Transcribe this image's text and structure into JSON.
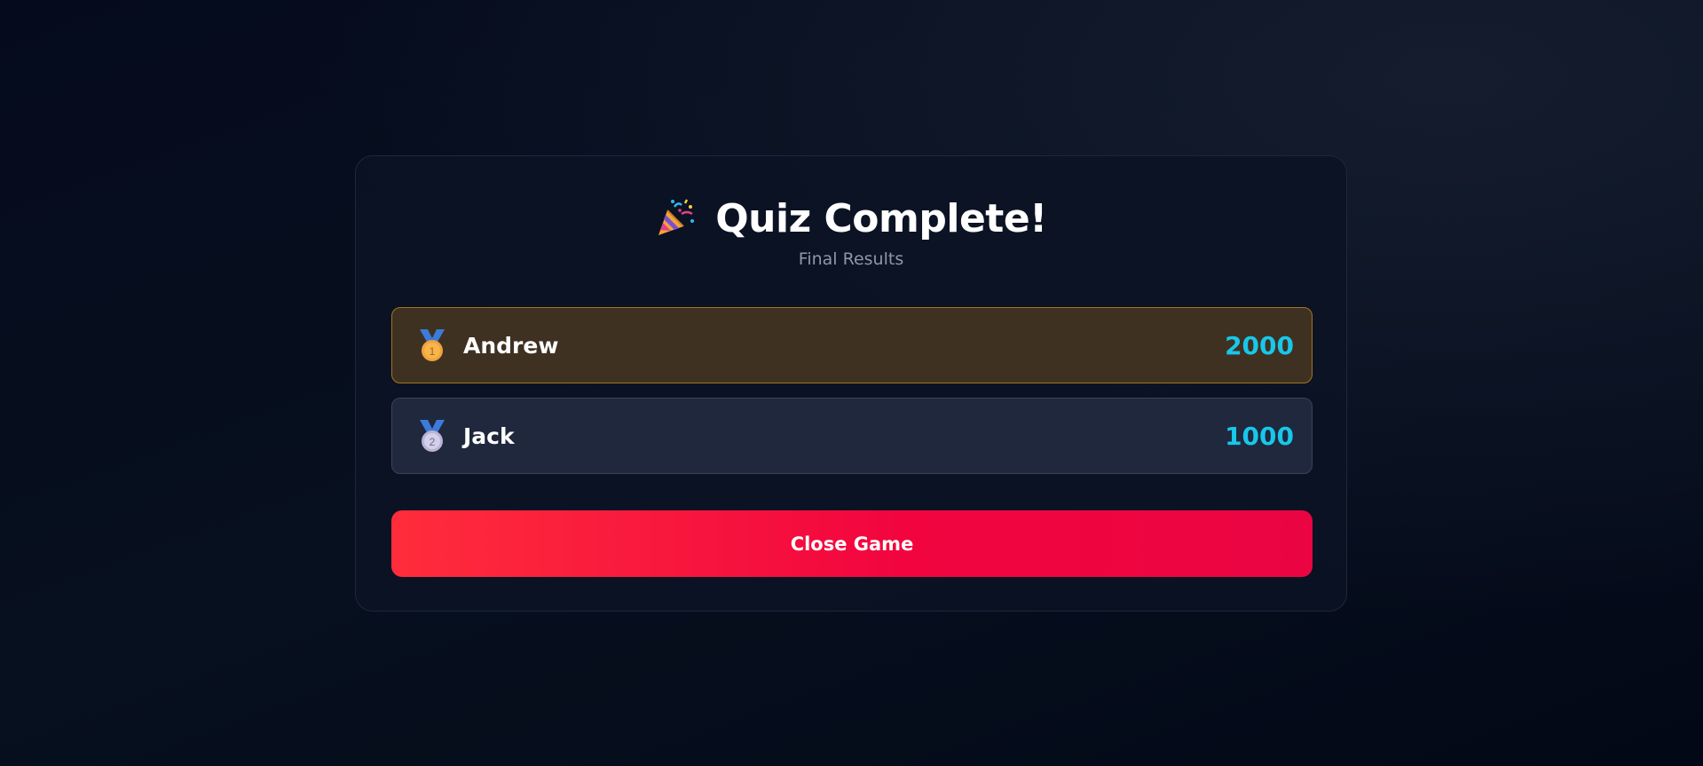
{
  "header": {
    "title": "Quiz Complete!",
    "title_icon": "party-popper-icon",
    "subtitle": "Final Results"
  },
  "leaderboard": [
    {
      "rank": 1,
      "name": "Andrew",
      "score": "2000",
      "medal_icon": "gold-medal-icon",
      "medal_digit": "1"
    },
    {
      "rank": 2,
      "name": "Jack",
      "score": "1000",
      "medal_icon": "silver-medal-icon",
      "medal_digit": "2"
    }
  ],
  "actions": {
    "close_label": "Close Game"
  },
  "colors": {
    "first_place_bg": "#3e3121",
    "first_place_border": "#a3741d",
    "row_bg": "#1f283c",
    "score": "#18c7ea",
    "close_button": "#f2053f"
  }
}
